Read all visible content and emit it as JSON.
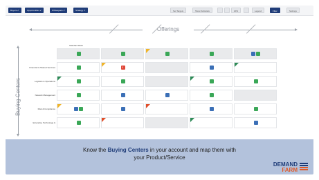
{
  "toolbar": {
    "dropdowns": [
      "Buyers ✔",
      "Opportunities ✔",
      "Whitespace ✔",
      "Strategy ✔"
    ],
    "buttons": [
      "Set Targets",
      "Show Subtotals",
      "20%",
      "Legend",
      "Filter",
      "Settings"
    ]
  },
  "offerings_title": "Offerings",
  "buying_centers_title": "Buying Centers",
  "columns": [
    "Standard Rack",
    "",
    "",
    "",
    ""
  ],
  "rows": [
    {
      "label": "",
      "cells": [
        {
          "icons": [
            "green"
          ],
          "flag": "",
          "bg": "gray"
        },
        {
          "icons": [
            "green"
          ],
          "flag": "",
          "bg": "gray"
        },
        {
          "icons": [
            "green"
          ],
          "flag": "yellow",
          "bg": "gray"
        },
        {
          "icons": [
            "green"
          ],
          "flag": "",
          "bg": "gray"
        },
        {
          "icons": [
            "blue",
            "green"
          ],
          "flag": "",
          "bg": "gray"
        }
      ]
    },
    {
      "label": "Financial & Shared Services",
      "cells": [
        {
          "icons": [
            "green"
          ],
          "flag": "",
          "bg": ""
        },
        {
          "icons": [
            "red"
          ],
          "flag": "yellow",
          "bg": ""
        },
        {
          "icons": [],
          "flag": "",
          "bg": "gray"
        },
        {
          "icons": [
            "blue"
          ],
          "flag": "",
          "bg": ""
        },
        {
          "icons": [],
          "flag": "green",
          "bg": ""
        }
      ]
    },
    {
      "label": "Logistics & Operations",
      "cells": [
        {
          "icons": [
            "green"
          ],
          "flag": "green",
          "bg": ""
        },
        {
          "icons": [
            "green"
          ],
          "flag": "",
          "bg": ""
        },
        {
          "icons": [],
          "flag": "",
          "bg": "gray"
        },
        {
          "icons": [
            "green"
          ],
          "flag": "green",
          "bg": ""
        },
        {
          "icons": [
            "green"
          ],
          "flag": "",
          "bg": ""
        }
      ]
    },
    {
      "label": "Network Management",
      "cells": [
        {
          "icons": [
            "green"
          ],
          "flag": "",
          "bg": ""
        },
        {
          "icons": [
            "blue"
          ],
          "flag": "",
          "bg": ""
        },
        {
          "icons": [
            "blue"
          ],
          "flag": "",
          "bg": ""
        },
        {
          "icons": [
            "green"
          ],
          "flag": "",
          "bg": ""
        },
        {
          "icons": [],
          "flag": "",
          "bg": "gray"
        }
      ]
    },
    {
      "label": "Risk & Compliance",
      "cells": [
        {
          "icons": [
            "blue",
            "green"
          ],
          "flag": "yellow",
          "bg": ""
        },
        {
          "icons": [
            "blue"
          ],
          "flag": "",
          "bg": ""
        },
        {
          "icons": [],
          "flag": "red",
          "bg": ""
        },
        {
          "icons": [
            "blue"
          ],
          "flag": "",
          "bg": ""
        },
        {
          "icons": [
            "green"
          ],
          "flag": "",
          "bg": ""
        }
      ]
    },
    {
      "label": "Enterprise Technology &",
      "cells": [
        {
          "icons": [
            "green"
          ],
          "flag": "",
          "bg": ""
        },
        {
          "icons": [],
          "flag": "red",
          "bg": ""
        },
        {
          "icons": [],
          "flag": "",
          "bg": "gray"
        },
        {
          "icons": [],
          "flag": "green",
          "bg": ""
        },
        {
          "icons": [
            "blue"
          ],
          "flag": "",
          "bg": ""
        }
      ]
    }
  ],
  "banner": {
    "line1_pre": "Know the ",
    "line1_bold": "Buying Centers",
    "line1_post": " in your account and map them with",
    "line2": "your Product/Service"
  },
  "logo": {
    "top": "DEMAND",
    "bottom": "FARM"
  },
  "colors": {
    "navy": "#1f3c78",
    "banner": "#b3c2dc",
    "green": "#3aa757",
    "blue": "#3b6fb6",
    "red": "#e0483a",
    "yellow": "#f0b428"
  }
}
